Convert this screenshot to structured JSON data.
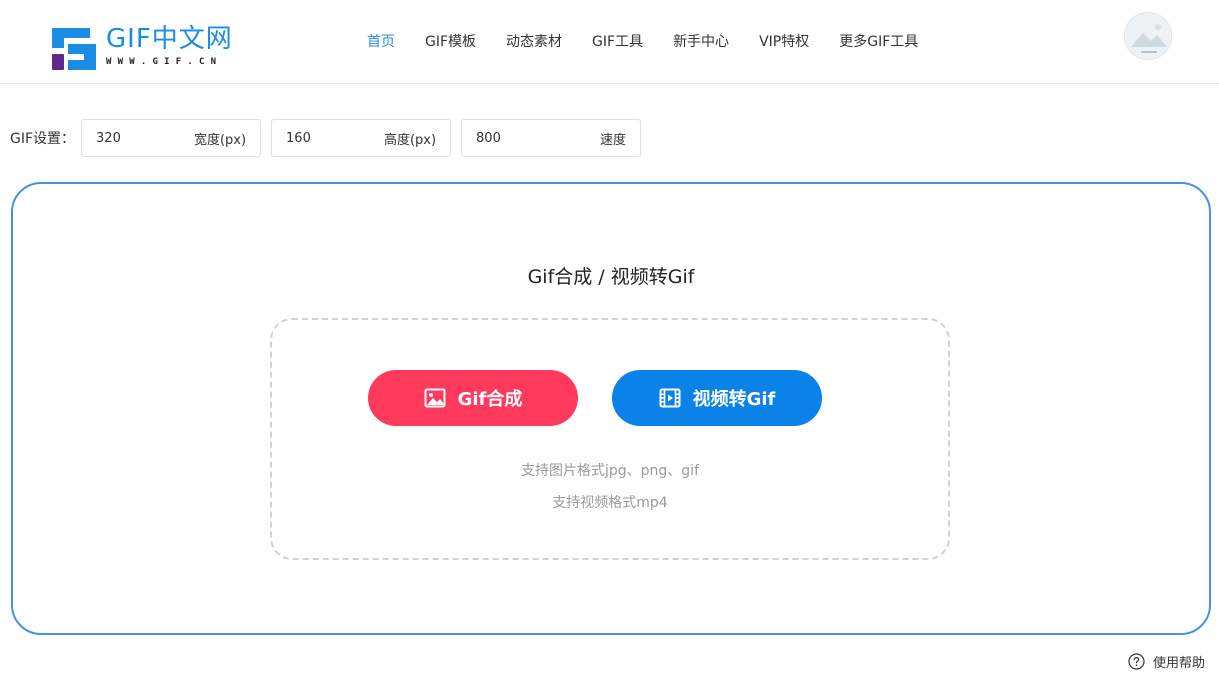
{
  "brand": {
    "title": "GIF中文网",
    "subtitle": "WWW.GIF.CN",
    "colors": {
      "blue": "#1b8ce3",
      "purple": "#5b2a8c"
    }
  },
  "nav": {
    "items": [
      {
        "label": "首页",
        "active": true
      },
      {
        "label": "GIF模板"
      },
      {
        "label": "动态素材"
      },
      {
        "label": "GIF工具"
      },
      {
        "label": "新手中心"
      },
      {
        "label": "VIP特权"
      },
      {
        "label": "更多GIF工具"
      }
    ],
    "active_color": "#2d8be0"
  },
  "avatar": {
    "icon": "landscape-avatar-icon"
  },
  "settings": {
    "label": "GIF设置：",
    "width": {
      "value": "320",
      "unit": "宽度(px)"
    },
    "height": {
      "value": "160",
      "unit": "高度(px)"
    },
    "speed": {
      "value": "800",
      "unit": "速度"
    }
  },
  "panel": {
    "title": "Gif合成 / 视频转Gif",
    "border_color": "#4a90e2",
    "buttons": {
      "gif_compose": {
        "label": "Gif合成",
        "icon": "image-icon",
        "color": "#ff3a5c"
      },
      "video_to_gif": {
        "label": "视频转Gif",
        "icon": "film-icon",
        "color": "#0a82e8"
      }
    },
    "hints": {
      "image_formats": "支持图片格式jpg、png、gif",
      "video_formats": "支持视频格式mp4"
    }
  },
  "help": {
    "label": "使用帮助",
    "icon": "question-circle-icon"
  }
}
